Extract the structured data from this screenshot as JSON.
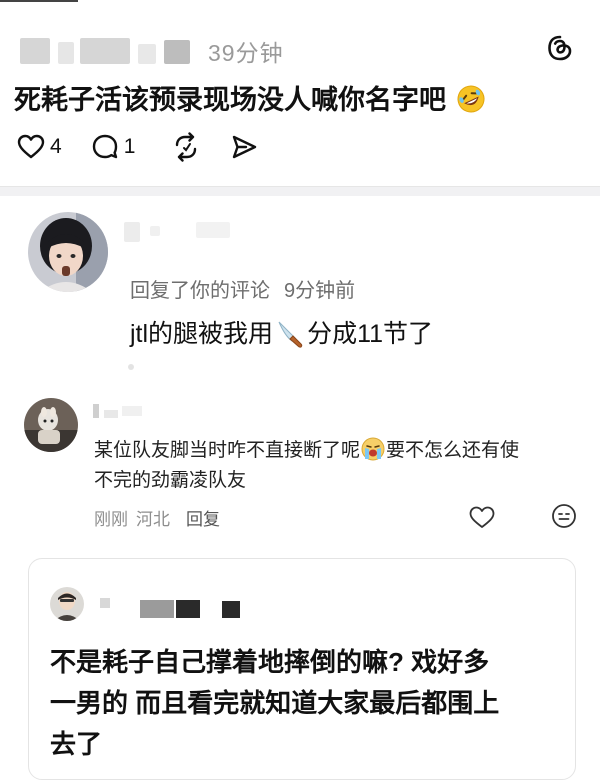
{
  "post": {
    "time": "39分钟",
    "text": "死耗子活该预录现场没人喊你名字吧",
    "emoji": "rolling-on-floor-laughing",
    "likes": "4",
    "comments": "1",
    "icons": [
      "heart-icon",
      "comment-icon",
      "repost-icon",
      "share-icon",
      "threads-logo-icon"
    ]
  },
  "reply_notice": {
    "meta": "回复了你的评论",
    "time": "9分钟前",
    "text_before": "jtl的腿被我用",
    "emoji": "kitchen-knife",
    "text_after": "分成11节了"
  },
  "comment": {
    "line1_before": "某位队友脚当时咋不直接断了呢",
    "emoji": "crying-face",
    "line1_after": "要不怎么还有使",
    "line2": "不完的劲霸凌队友",
    "time": "刚刚",
    "location": "河北",
    "reply_label": "回复",
    "icons": [
      "heart-outline-icon",
      "emoji-face-icon"
    ]
  },
  "quote": {
    "line1": "不是耗子自己撑着地摔倒的嘛? 戏好多",
    "line2": "一男的 而且看完就知道大家最后都围上",
    "line3": "去了"
  },
  "colors": {
    "text": "#111111",
    "muted": "#9a9a9a",
    "meta": "#6e6e6e",
    "divider": "#f1f1f3"
  }
}
